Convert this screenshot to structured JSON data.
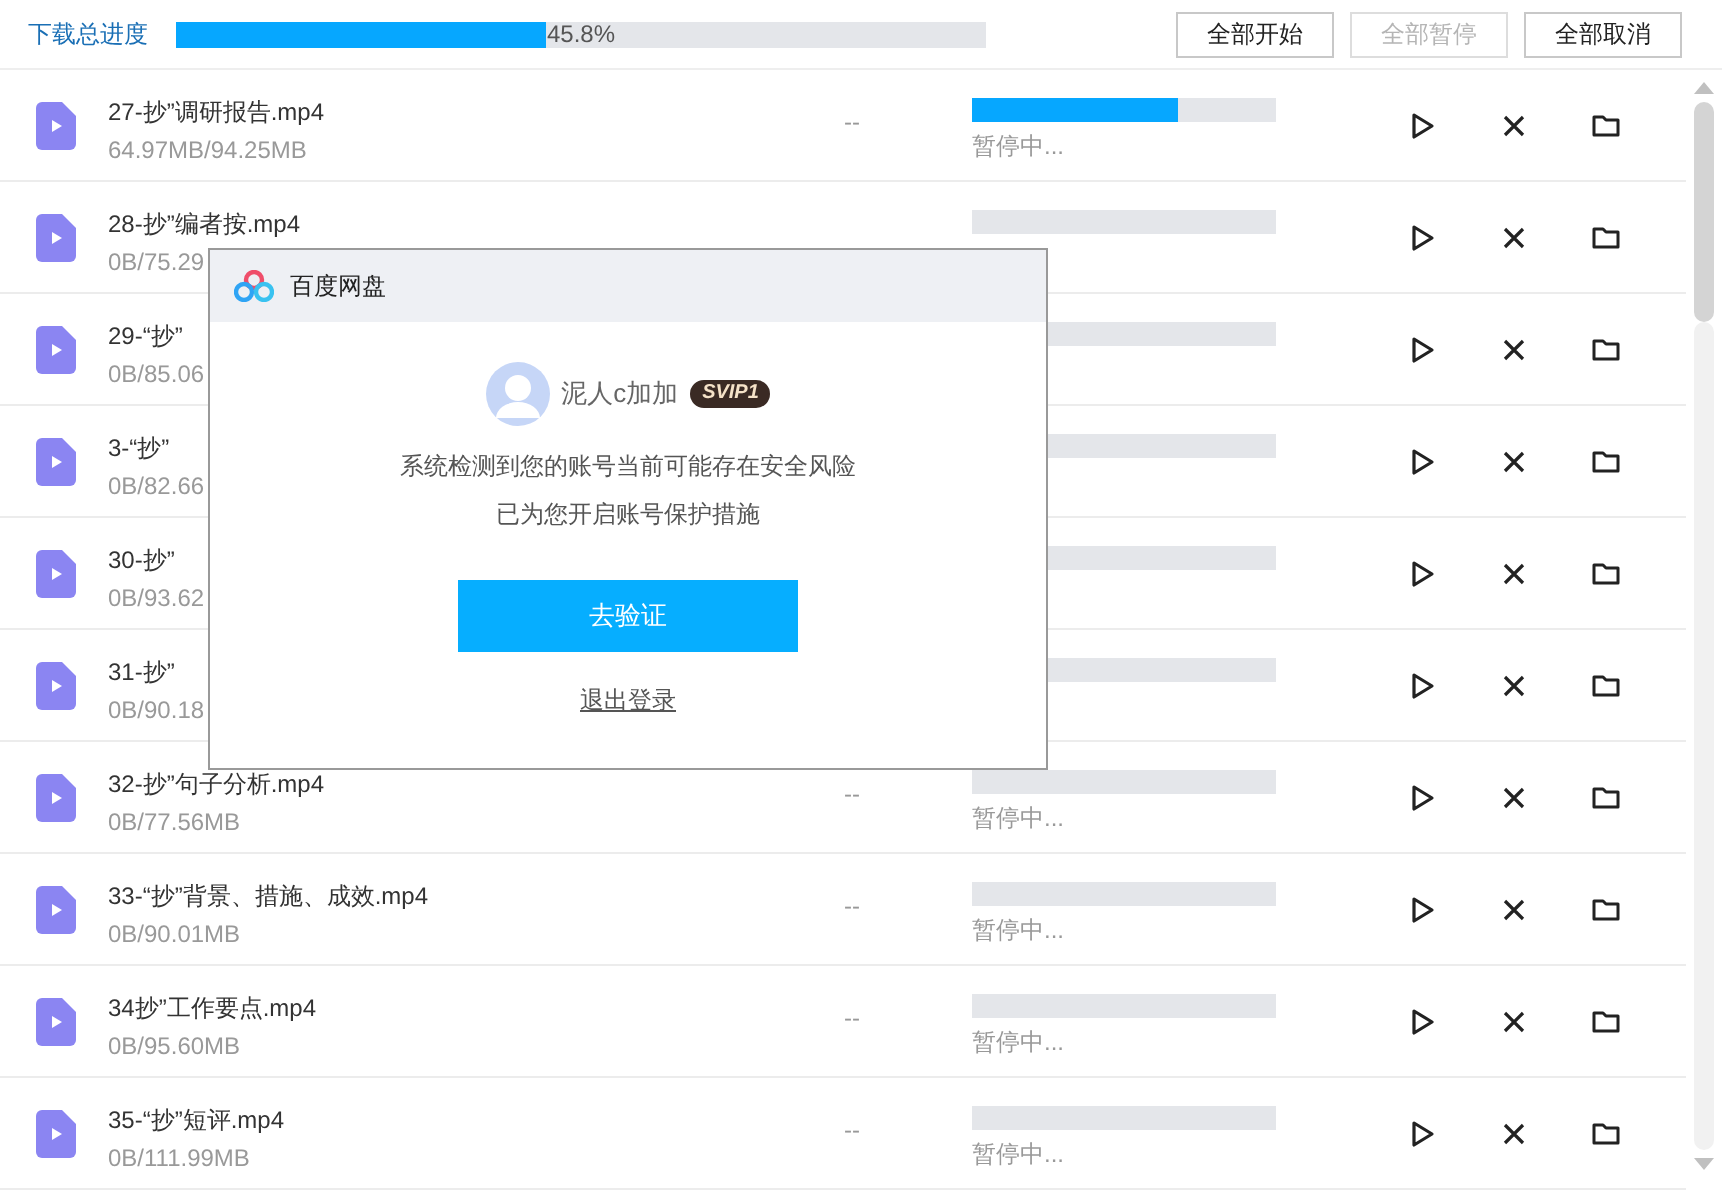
{
  "header": {
    "label": "下载总进度",
    "level": 0.458,
    "percent": "45.8%",
    "buttons": [
      {
        "label": "全部开始",
        "disabled": false
      },
      {
        "label": "全部暂停",
        "disabled": true
      },
      {
        "label": "全部取消",
        "disabled": false
      }
    ]
  },
  "rows": [
    {
      "name": "27-抄”调研报告.mp4",
      "size": "64.97MB/94.25MB",
      "speed": "--",
      "level": 0.68,
      "status": "暂停中..."
    },
    {
      "name": "28-抄”编者按.mp4",
      "size": "0B/75.29"
    },
    {
      "name": "29-“抄”",
      "size": "0B/85.06"
    },
    {
      "name": "3-“抄”",
      "size": "0B/82.66"
    },
    {
      "name": "30-抄”",
      "size": "0B/93.62"
    },
    {
      "name": "31-抄”",
      "size": "0B/90.18"
    },
    {
      "name": "32-抄”句子分析.mp4",
      "size": "0B/77.56MB",
      "speed": "--",
      "status": "暂停中..."
    },
    {
      "name": "33-“抄”背景、措施、成效.mp4",
      "size": "0B/90.01MB",
      "speed": "--",
      "status": "暂停中..."
    },
    {
      "name": "34抄”工作要点.mp4",
      "size": "0B/95.60MB",
      "speed": "--",
      "status": "暂停中..."
    },
    {
      "name": "35-“抄”短评.mp4",
      "size": "0B/111.99MB",
      "speed": "--",
      "status": "暂停中..."
    }
  ],
  "dialog": {
    "title": "百度网盘",
    "user": "泥人c加加",
    "badge": "SVIP1",
    "message": [
      "系统检测到您的账号当前可能存在安全风险",
      "已为您开启账号保护措施"
    ],
    "primary": "去验证",
    "link": "退出登录"
  }
}
